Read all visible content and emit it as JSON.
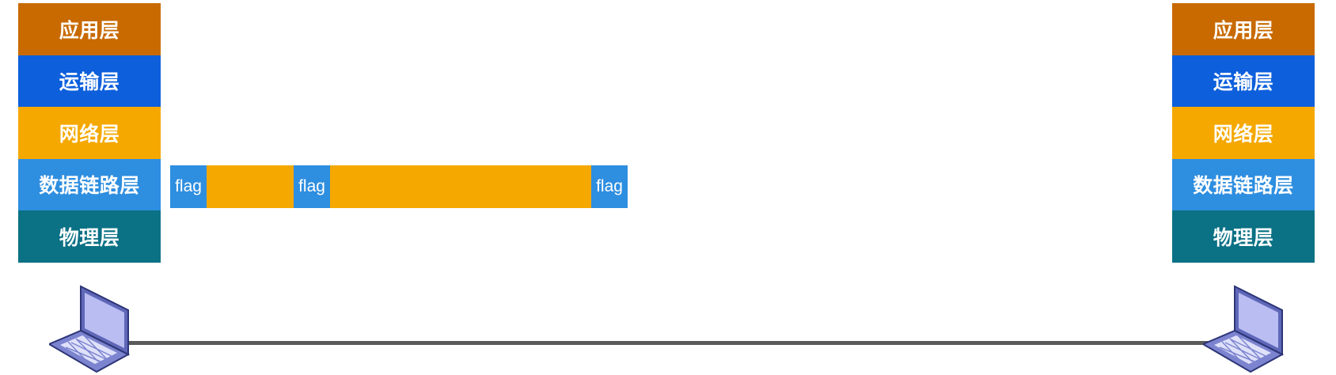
{
  "left_stack": {
    "layers": [
      {
        "label": "应用层",
        "color": "#c86a00"
      },
      {
        "label": "运输层",
        "color": "#0d5fdc"
      },
      {
        "label": "网络层",
        "color": "#f5a800"
      },
      {
        "label": "数据链路层",
        "color": "#2e8ee0"
      },
      {
        "label": "物理层",
        "color": "#0b7185"
      }
    ]
  },
  "right_stack": {
    "layers": [
      {
        "label": "应用层",
        "color": "#c86a00"
      },
      {
        "label": "运输层",
        "color": "#0d5fdc"
      },
      {
        "label": "网络层",
        "color": "#f5a800"
      },
      {
        "label": "数据链路层",
        "color": "#2e8ee0"
      },
      {
        "label": "物理层",
        "color": "#0b7185"
      }
    ]
  },
  "frame": {
    "segments": [
      {
        "type": "flag",
        "label": "flag"
      },
      {
        "type": "data",
        "label": ""
      },
      {
        "type": "flag",
        "label": "flag"
      },
      {
        "type": "data",
        "label": ""
      },
      {
        "type": "flag",
        "label": "flag"
      }
    ],
    "flag_color": "#2e8ee0",
    "data_color": "#f5a800"
  },
  "hosts": [
    {
      "icon": "laptop-icon"
    },
    {
      "icon": "laptop-icon"
    }
  ],
  "link_color": "#5a5a5a"
}
